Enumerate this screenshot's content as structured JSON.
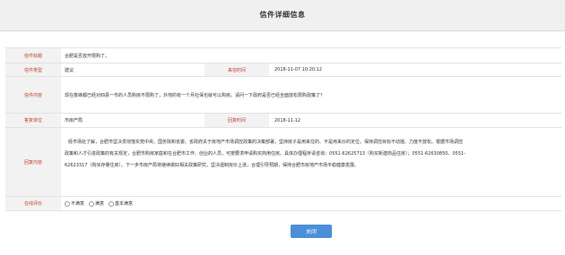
{
  "page": {
    "title": "信件详细信息"
  },
  "letter": {
    "subject_label": "信件标题",
    "subject_value": "合肥是否放开限购了。",
    "type_label": "信件类型",
    "type_value": "建议",
    "write_time_label": "来信时间",
    "write_time_value": "2018-11-07 10:20:12",
    "content_label": "信件内容",
    "content_value": "现在像锋都已经对四县一市的人员购房不限购了，外地的有一个月社保也就可以购房。请问一下政府是否已经全面放松限购政策了？",
    "reply_unit_label": "答复单位",
    "reply_unit_value": "市房产局",
    "reply_time_label": "回复时间",
    "reply_time_value": "2018-11-12",
    "reply_content_label": "回复内容",
    "reply_content_lines": [
      "经市场处了解，合肥市坚决贯彻落实党中央、国务院和省委、省政府关于房地产市场调控政策的决策部署，坚持房子是用来住的、不是用来炒的定位，保持调控目标不动摇、力度不放松。根据市场调控",
      "政策和人才引进政策的有关规定，合肥市购房家庭和在合肥市工作、创业的人员，可按要求申请购买商用住房。具体办理程序请咨询：0551-62625713（购买新建商品住房）；0551-62630850、0551-",
      "62623317（购买存量住房）。下一步市房产局将继续做好相关政策研究，坚决遏制房价上涨，合理引导预期，保持合肥市房地产市场平稳健康发展。"
    ],
    "rating_label": "在线评价",
    "rating_options": [
      "不满意",
      "满意",
      "基本满意"
    ]
  },
  "actions": {
    "close_label": "关闭"
  }
}
